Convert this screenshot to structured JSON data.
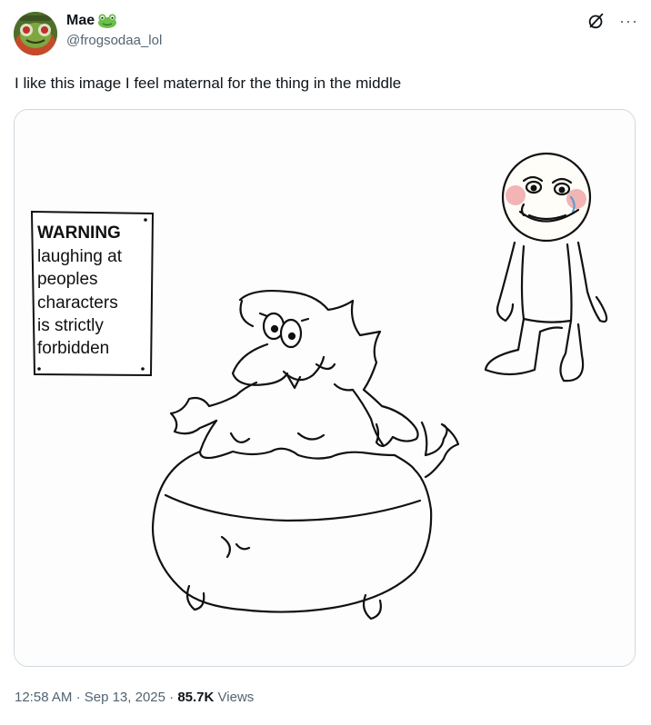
{
  "tweet": {
    "author": {
      "display_name": "Mae",
      "handle": "@frogsodaa_lol",
      "name_emoji": "frog-emoji",
      "avatar": "frog-avatar-icon"
    },
    "text": "I like this image I feel maternal for the thing in the middle",
    "media": {
      "sign_lines": [
        "WARNING",
        "laughing at",
        "peoples",
        "characters",
        "is strictly",
        "forbidden"
      ]
    },
    "meta": {
      "time": "12:58 AM",
      "separator": "·",
      "date": "Sep 13, 2025",
      "views_count": "85.7K",
      "views_label": "Views"
    },
    "actions": {
      "grok_icon": "grok-icon",
      "more_icon": "more-icon",
      "more_label": "···"
    }
  }
}
